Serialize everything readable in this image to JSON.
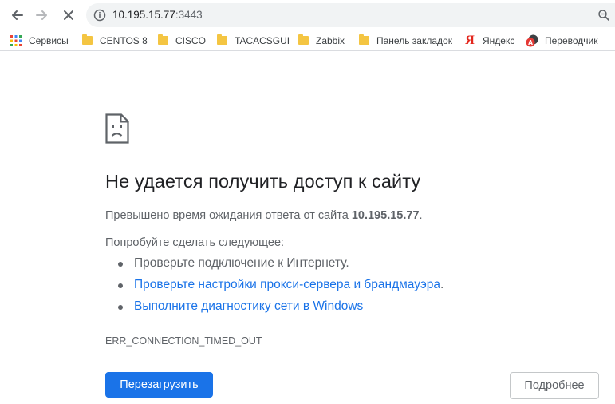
{
  "browser": {
    "url_host": "10.195.15.77",
    "url_port": ":3443"
  },
  "bookmarks": [
    {
      "label": "Сервисы",
      "icon": "apps-grid-icon"
    },
    {
      "label": "CENTOS 8",
      "icon": "folder-icon"
    },
    {
      "label": "CISCO",
      "icon": "folder-icon"
    },
    {
      "label": "TACACSGUI",
      "icon": "folder-icon"
    },
    {
      "label": "Zabbix",
      "icon": "folder-icon"
    },
    {
      "label": "Панель закладок",
      "icon": "folder-icon"
    },
    {
      "label": "Яндекс",
      "icon": "yandex-icon"
    },
    {
      "label": "Переводчик",
      "icon": "translator-icon"
    }
  ],
  "error": {
    "title": "Не удается получить доступ к сайту",
    "desc_prefix": "Превышено время ожидания ответа от сайта ",
    "desc_host": "10.195.15.77",
    "desc_suffix": ".",
    "try_label": "Попробуйте сделать следующее:",
    "suggestions": [
      {
        "text": "Проверьте подключение к Интернету.",
        "link": false
      },
      {
        "text": "Проверьте настройки прокси-сервера и брандмауэра",
        "link": true,
        "tail": "."
      },
      {
        "text": "Выполните диагностику сети в Windows",
        "link": true
      }
    ],
    "code": "ERR_CONNECTION_TIMED_OUT",
    "reload_label": "Перезагрузить",
    "details_label": "Подробнее"
  },
  "colors": {
    "accent": "#1a73e8",
    "text_primary": "#202124",
    "text_secondary": "#5f6368",
    "folder": "#f4c542"
  }
}
